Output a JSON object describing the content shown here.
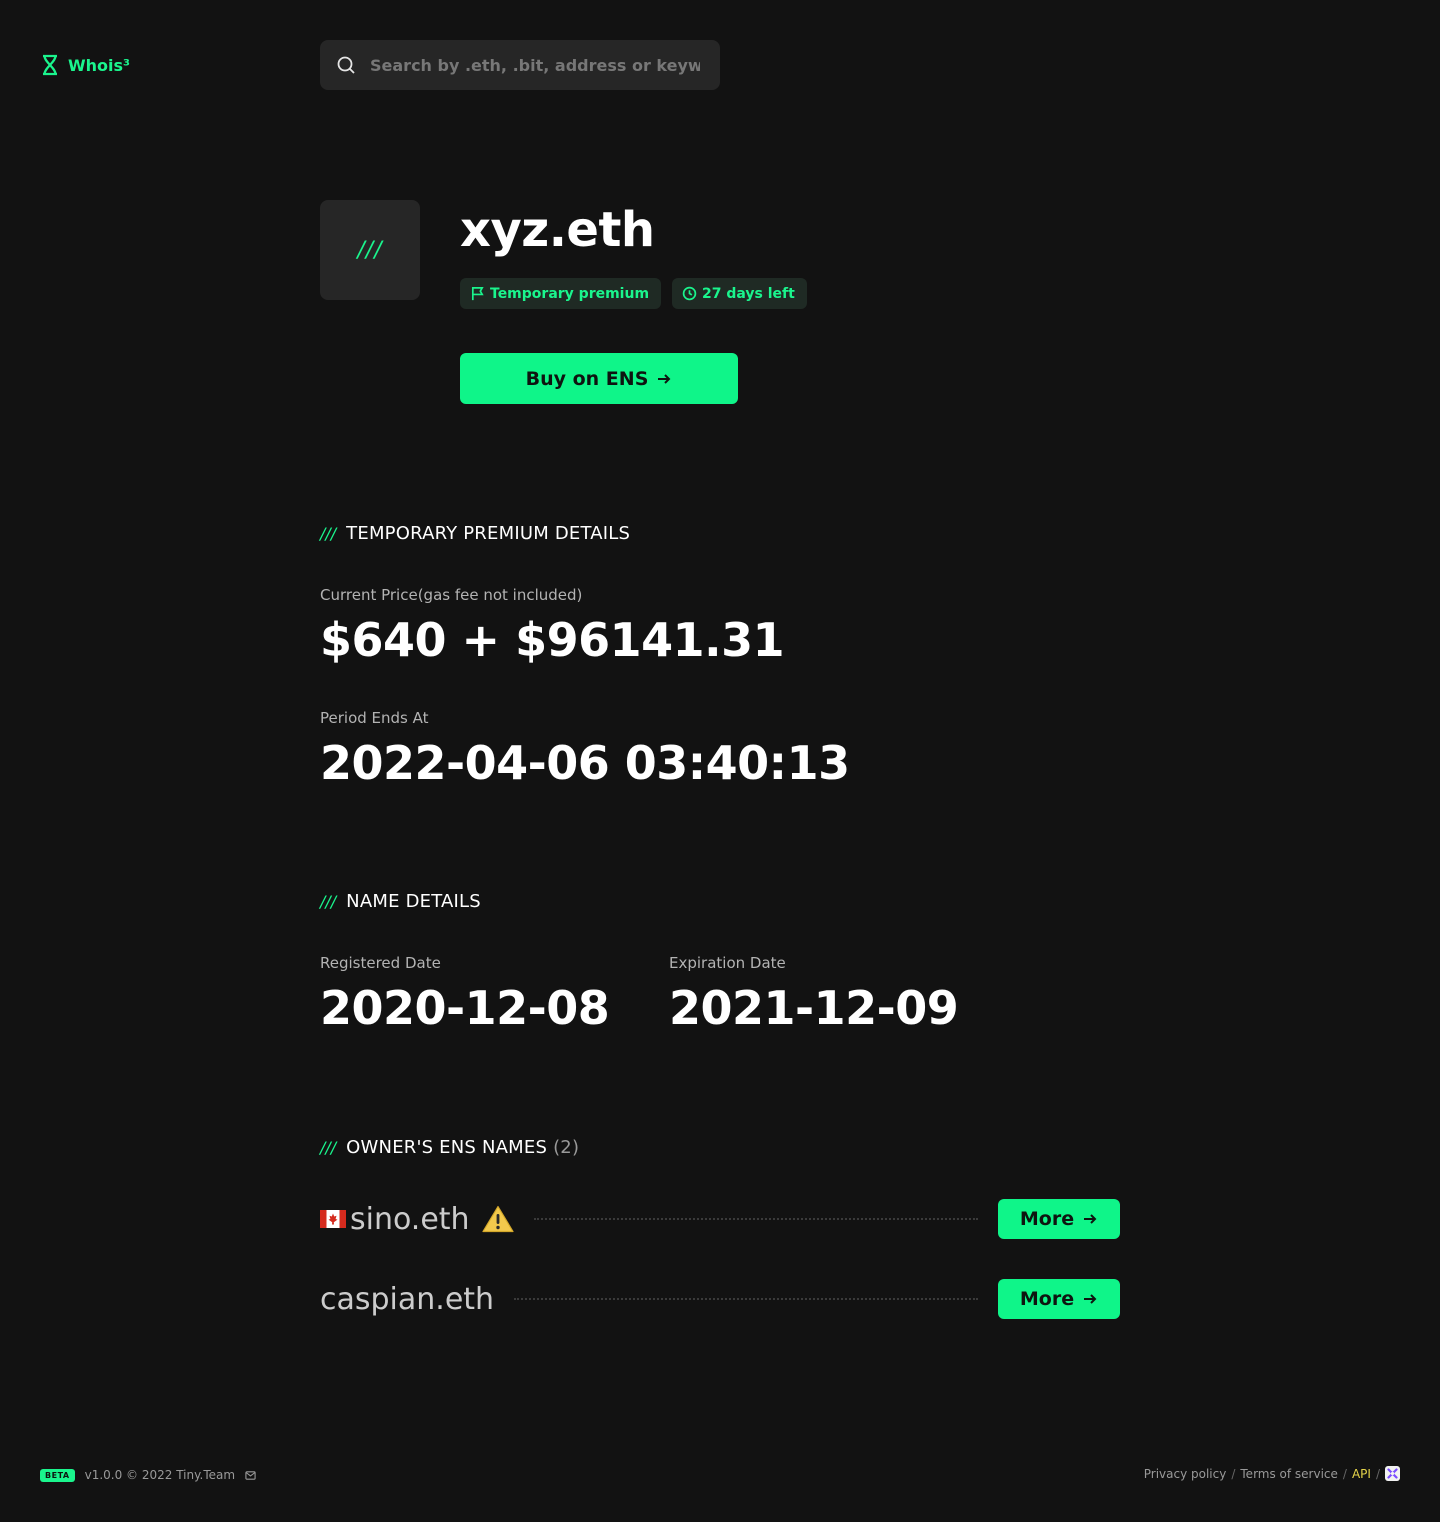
{
  "brand": {
    "name": "Whois³",
    "accent": "#1af58d"
  },
  "search": {
    "placeholder": "Search by .eth, .bit, address or keyword"
  },
  "profile": {
    "avatar_text": "///",
    "name": "xyz.eth",
    "tags": [
      {
        "label": "Temporary premium",
        "icon": "flag-icon"
      },
      {
        "label": "27 days left",
        "icon": "clock-icon"
      }
    ],
    "buy_label": "Buy on ENS"
  },
  "premium": {
    "heading": "TEMPORARY PREMIUM DETAILS",
    "price_label": "Current Price(gas fee not included)",
    "price_value": "$640 + $96141.31",
    "period_label": "Period Ends At",
    "period_value": "2022-04-06 03:40:13"
  },
  "name_details": {
    "heading": "NAME DETAILS",
    "registered_label": "Registered Date",
    "registered_value": "2020-12-08",
    "expiration_label": "Expiration Date",
    "expiration_value": "2021-12-09"
  },
  "owner_names": {
    "heading": "OWNER'S ENS NAMES",
    "count": "(2)",
    "items": [
      {
        "name": "sino.eth",
        "flag": "canada-flag-icon",
        "warning": true,
        "button": "More"
      },
      {
        "name": "caspian.eth",
        "flag": null,
        "warning": false,
        "button": "More"
      }
    ]
  },
  "footer": {
    "badge": "BETA",
    "version": "v1.0.0 © 2022 Tiny.Team",
    "links": [
      "Privacy policy",
      "Terms of service",
      "API"
    ],
    "separator": "/"
  }
}
